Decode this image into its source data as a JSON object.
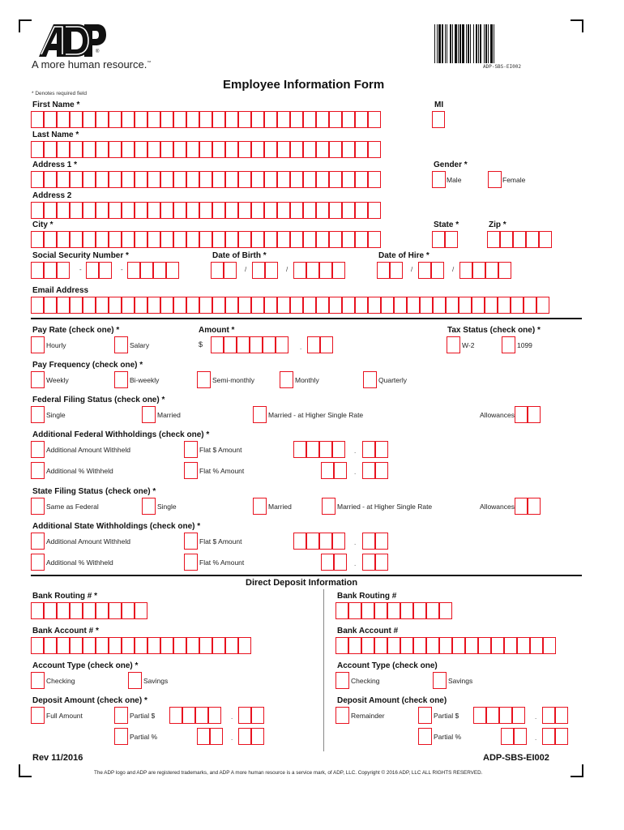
{
  "header": {
    "logo_text": "ADP",
    "tagline": "A more human resource.",
    "tagline_mark": "™",
    "barcode_text": "ADP-SBS-EI002",
    "title": "Employee Information Form",
    "required_note": "* Denotes required field"
  },
  "colors": {
    "field_border": "#e8121f",
    "text": "#111111"
  },
  "personal": {
    "first_name": "First Name *",
    "mi": "MI",
    "last_name": "Last Name *",
    "address1": "Address 1 *",
    "gender": "Gender *",
    "gender_options": [
      "Male",
      "Female"
    ],
    "address2": "Address 2",
    "city": "City *",
    "state": "State *",
    "zip": "Zip *",
    "ssn": "Social Security Number *",
    "dob": "Date of Birth *",
    "doh": "Date of Hire *",
    "email": "Email Address",
    "dash": "-",
    "slash": "/"
  },
  "pay": {
    "pay_rate": "Pay Rate (check one) *",
    "pay_rate_options": [
      "Hourly",
      "Salary"
    ],
    "amount": "Amount *",
    "dollar": "$",
    "dot": ".",
    "tax_status": "Tax Status (check one) *",
    "tax_options": [
      "W-2",
      "1099"
    ],
    "frequency": "Pay Frequency (check one) *",
    "frequency_options": [
      "Weekly",
      "Bi-weekly",
      "Semi-monthly",
      "Monthly",
      "Quarterly"
    ],
    "federal_status": "Federal Filing Status (check one) *",
    "federal_options": [
      "Single",
      "Married",
      "Married - at Higher Single Rate"
    ],
    "allowances": "Allowances",
    "fed_withholdings": "Additional Federal Withholdings (check one) *",
    "withholding_options": [
      "Additional Amount Withheld",
      "Additional % Withheld"
    ],
    "flat_options": [
      "Flat $ Amount",
      "Flat % Amount"
    ],
    "state_status": "State Filing Status (check one) *",
    "state_options": [
      "Same as Federal",
      "Single",
      "Married",
      "Married - at Higher Single Rate"
    ],
    "state_withholdings": "Additional State Withholdings (check one) *"
  },
  "deposit": {
    "heading": "Direct Deposit Information",
    "left": {
      "routing": "Bank Routing # *",
      "account": "Bank Account # *",
      "type": "Account Type (check one) *",
      "type_options": [
        "Checking",
        "Savings"
      ],
      "amount": "Deposit Amount (check one) *",
      "amount_options": [
        "Full Amount",
        "Partial $",
        "Partial %"
      ]
    },
    "right": {
      "routing": "Bank Routing #",
      "account": "Bank Account #",
      "type": "Account Type (check one)",
      "type_options": [
        "Checking",
        "Savings"
      ],
      "amount": "Deposit Amount (check one)",
      "amount_options": [
        "Remainder",
        "Partial $",
        "Partial %"
      ]
    }
  },
  "footer": {
    "revision": "Rev 11/2016",
    "form_id": "ADP-SBS-EI002",
    "legal": "The ADP logo and ADP are registered trademarks, and ADP A more human resource is a service mark, of ADP, LLC.  Copyright © 2016 ADP, LLC ALL RIGHTS RESERVED."
  }
}
